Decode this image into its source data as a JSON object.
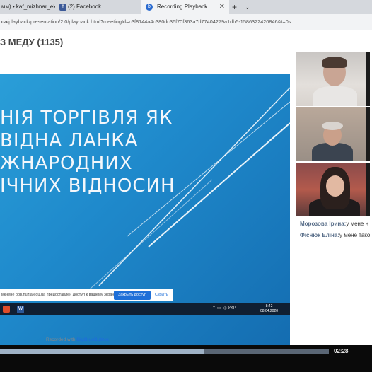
{
  "tabs": [
    {
      "label": "мм) • kaf_mizhnar_ek",
      "icon": "mail-icon",
      "active": false
    },
    {
      "label": "(2) Facebook",
      "icon": "facebook-icon",
      "active": false
    },
    {
      "label": "Recording Playback",
      "icon": "bigbluebutton-icon",
      "active": true
    }
  ],
  "tab_close_glyph": "✕",
  "new_tab_glyph": "+",
  "tab_menu_glyph": "⌄",
  "url": {
    "host": ".ua",
    "path": "/playback/presentation/2.0/playback.html?meetingId=c3f8144a4c380dc36f70f363a7d77404279a1db5-1586322420846&t=0s"
  },
  "page_title": "З МЕДУ (1135)",
  "slide": {
    "lines": [
      "НІЯ ТОРГІВЛЯ ЯК",
      "ВІДНА ЛАНКА",
      "ЖНАРОДНИХ",
      "ІЧНИХ ВІДНОСИН"
    ],
    "share_prompt": "мкнене bbb.nuzla.edu.ua предоставлен доступ к вашему экрану.",
    "share_button": "Закрыть доступ",
    "hide_link": "Скрыть",
    "taskbar_tray": "⌃ ▭ ◁) УКР",
    "taskbar_time": "8:42",
    "taskbar_date": "08.04.2020",
    "word_icon_letter": "W"
  },
  "recorded_with": {
    "prefix": "Recorded with ",
    "brand": "BigBlueButton"
  },
  "chat": [
    {
      "sender": "Морозова Ірина:",
      "text": "у мене н"
    },
    {
      "sender": "Фіснюк Еліна:",
      "text": "у мене тако"
    }
  ],
  "player": {
    "progress_fraction": 0.62,
    "time": "02:28"
  },
  "colors": {
    "accent": "#1e6fd8",
    "slide_bg": "#2a9ed8",
    "player_bg": "#0a0a0a"
  }
}
